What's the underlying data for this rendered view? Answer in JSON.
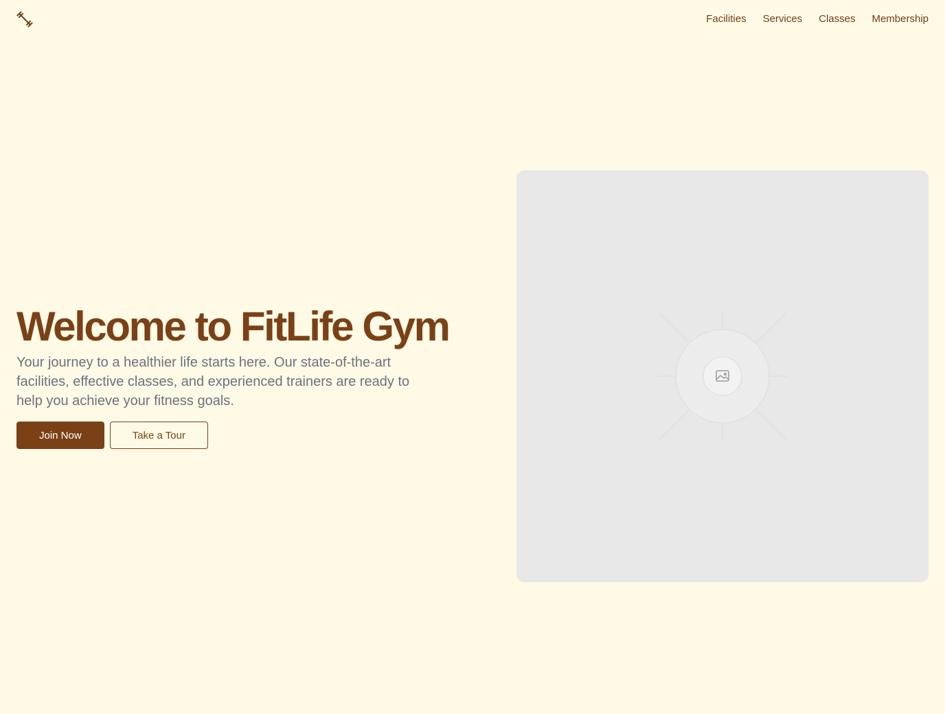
{
  "header": {
    "logo_icon": "dumbbell-icon",
    "nav": [
      {
        "label": "Facilities"
      },
      {
        "label": "Services"
      },
      {
        "label": "Classes"
      },
      {
        "label": "Membership"
      }
    ]
  },
  "hero": {
    "title": "Welcome to FitLife Gym",
    "description": "Your journey to a healthier life starts here. Our state-of-the-art facilities, effective classes, and experienced trainers are ready to help you achieve your fitness goals.",
    "primary_button": "Join Now",
    "secondary_button": "Take a Tour",
    "image_icon": "image-placeholder-icon"
  },
  "colors": {
    "background": "#fefae6",
    "accent": "#7a4117",
    "body_text": "#6b7280",
    "placeholder": "#e8e8e8"
  }
}
